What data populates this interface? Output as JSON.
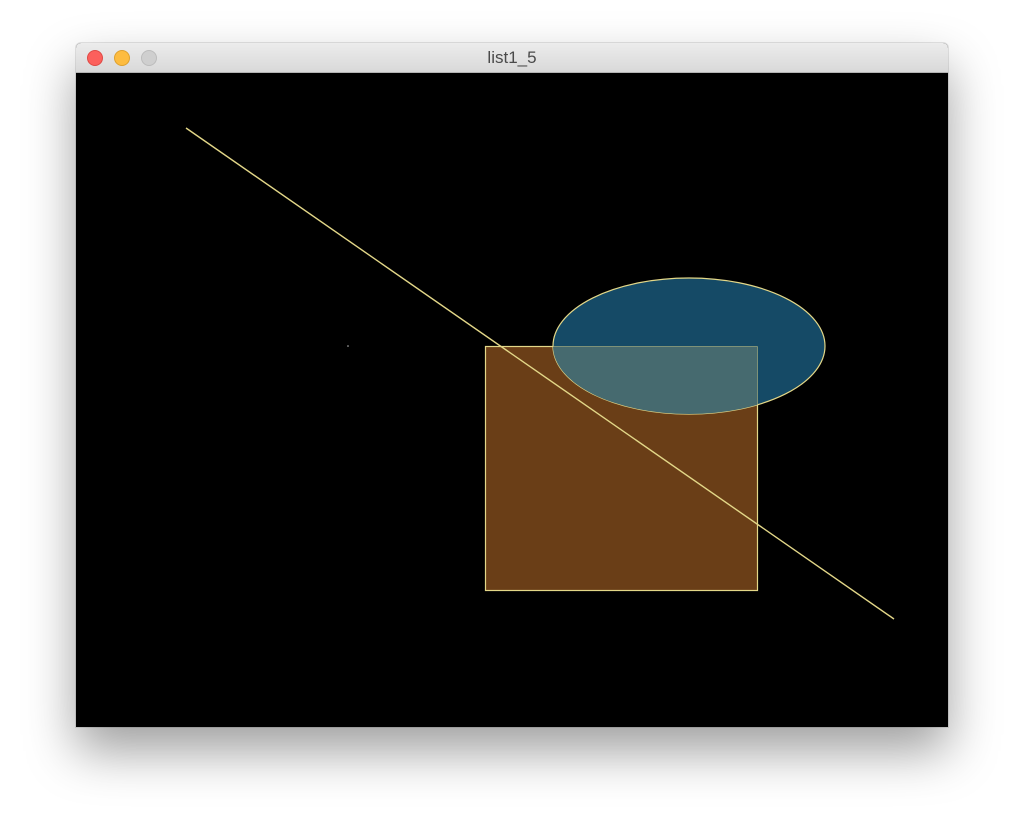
{
  "window": {
    "title": "list1_5"
  },
  "sketch": {
    "background": "#000000",
    "stroke": "#e3d788",
    "rect_fill": "#6a3e17",
    "ellipse_fill": "#154a66",
    "overlap_fill": "#466a6f"
  }
}
